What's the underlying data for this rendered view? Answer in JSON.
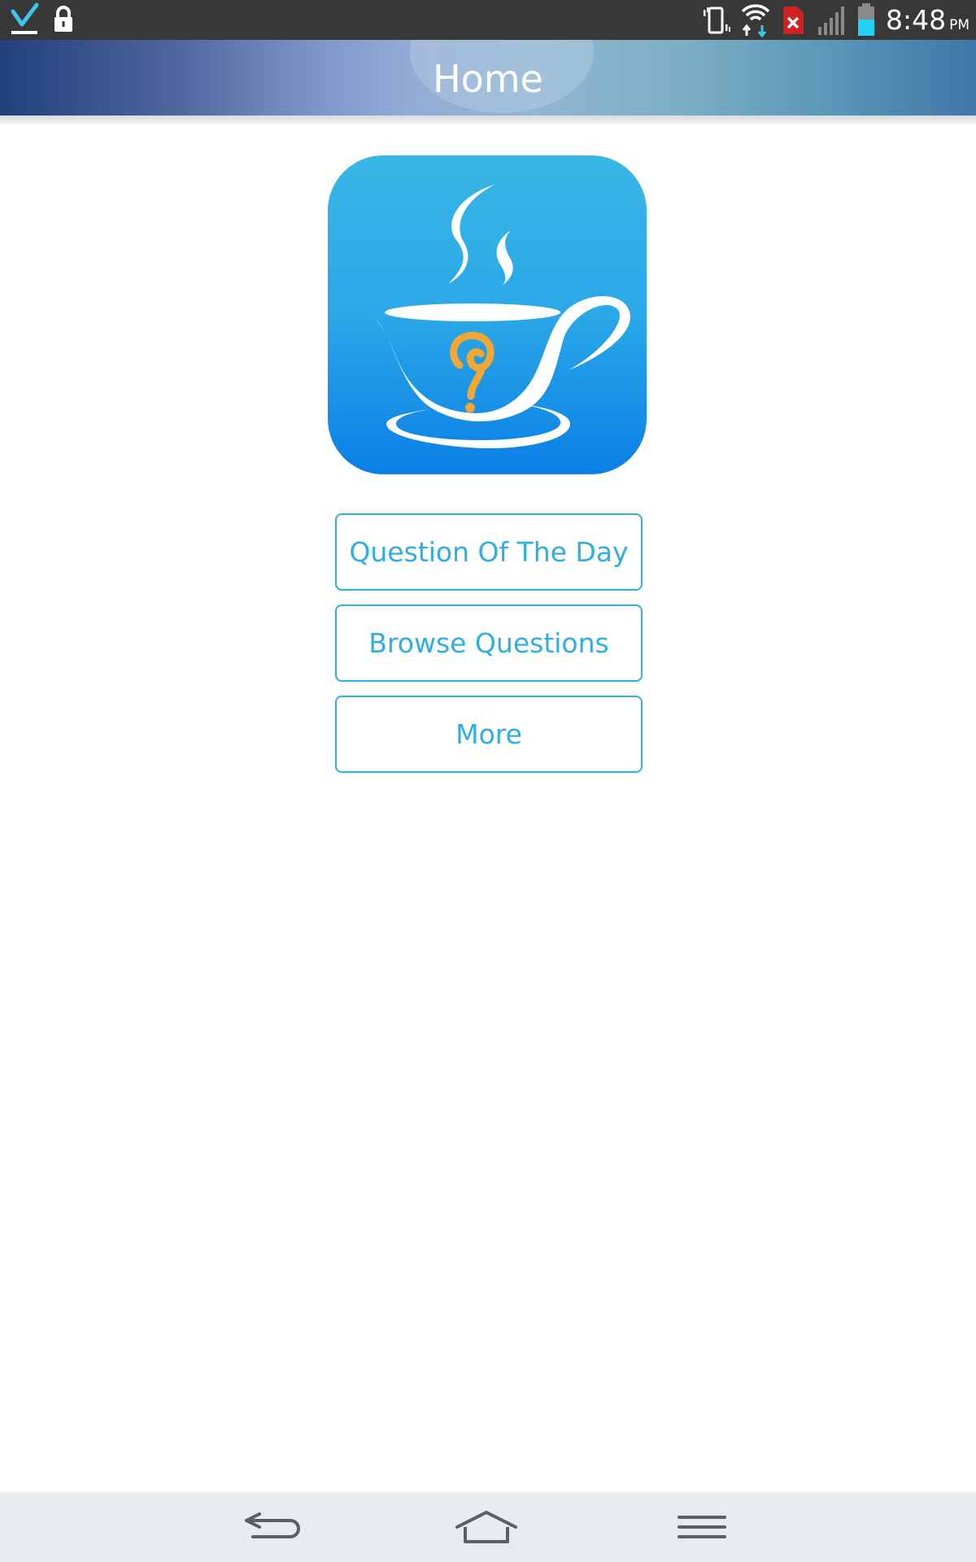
{
  "status_bar": {
    "time": "8:48",
    "ampm": "PM",
    "icons": [
      "download-check-icon",
      "lock-icon",
      "vibrate-icon",
      "wifi-icon",
      "sim-error-icon",
      "signal-icon",
      "battery-icon"
    ]
  },
  "header": {
    "title": "Home"
  },
  "logo": {
    "icon": "coffee-cup-question-icon"
  },
  "menu": {
    "buttons": [
      {
        "label": "Question Of The Day"
      },
      {
        "label": "Browse Questions"
      },
      {
        "label": "More"
      }
    ]
  },
  "nav_bar": {
    "icons": [
      "back-icon",
      "home-icon",
      "menu-icon"
    ]
  },
  "colors": {
    "accent": "#2eaee3",
    "status_bar": "#383838",
    "logo_question_mark": "#f2a633",
    "nav_bar": "#e8ebee"
  }
}
